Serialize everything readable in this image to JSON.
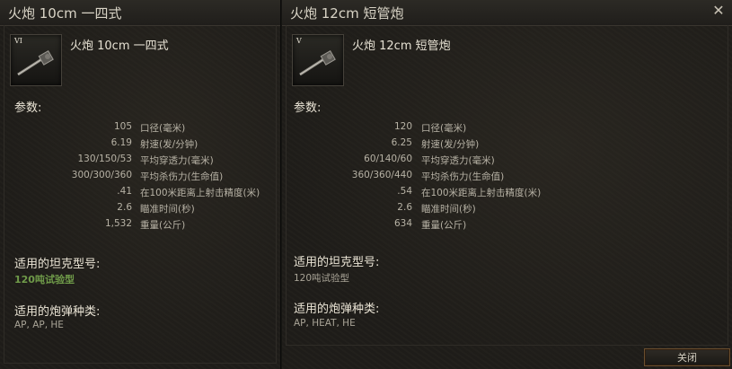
{
  "left": {
    "title": "火炮 10cm 一四式",
    "tier": "VI",
    "name": "火炮 10cm 一四式",
    "params_label": "参数:",
    "specs": [
      {
        "value": "105",
        "label": "口径(毫米)"
      },
      {
        "value": "6.19",
        "label": "射速(发/分钟)"
      },
      {
        "value": "130/150/53",
        "label": "平均穿透力(毫米)"
      },
      {
        "value": "300/300/360",
        "label": "平均杀伤力(生命值)"
      },
      {
        "value": ".41",
        "label": "在100米距离上射击精度(米)"
      },
      {
        "value": "2.6",
        "label": "瞄准时间(秒)"
      },
      {
        "value": "1,532",
        "label": "重量(公斤)"
      }
    ],
    "tanks_label": "适用的坦克型号:",
    "tanks_value": "120吨试验型",
    "shells_label": "适用的炮弹种类:",
    "shells_value": "AP, AP, HE"
  },
  "right": {
    "title": "火炮 12cm 短管炮",
    "tier": "V",
    "name": "火炮 12cm 短管炮",
    "params_label": "参数:",
    "specs": [
      {
        "value": "120",
        "label": "口径(毫米)"
      },
      {
        "value": "6.25",
        "label": "射速(发/分钟)"
      },
      {
        "value": "60/140/60",
        "label": "平均穿透力(毫米)"
      },
      {
        "value": "360/360/440",
        "label": "平均杀伤力(生命值)"
      },
      {
        "value": ".54",
        "label": "在100米距离上射击精度(米)"
      },
      {
        "value": "2.6",
        "label": "瞄准时间(秒)"
      },
      {
        "value": "634",
        "label": "重量(公斤)"
      }
    ],
    "tanks_label": "适用的坦克型号:",
    "tanks_value": "120吨试验型",
    "shells_label": "适用的炮弹种类:",
    "shells_value": "AP, HEAT, HE",
    "close_x": "✕",
    "close_button": "关闭"
  },
  "colors": {
    "tank_highlight": "#6f9a49",
    "button_border": "#6a4e2e"
  },
  "icons": [
    "gun-icon",
    "close-icon"
  ]
}
